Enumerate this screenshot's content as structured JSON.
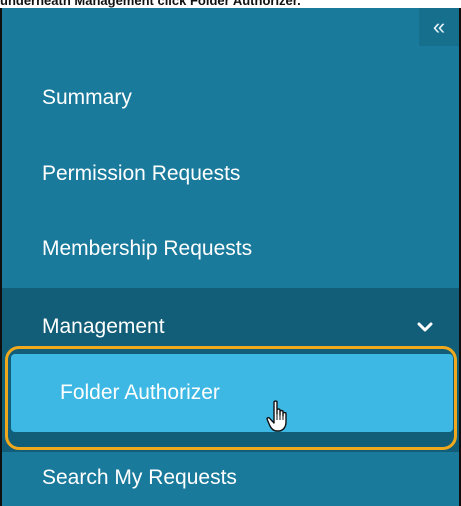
{
  "caption": "underneath Management click Folder Authorizer.",
  "sidebar": {
    "collapse_label": "«",
    "items": {
      "summary": "Summary",
      "permission_requests": "Permission Requests",
      "membership_requests": "Membership Requests",
      "management": "Management",
      "folder_authorizer": "Folder Authorizer",
      "search_my_requests": "Search My Requests"
    }
  },
  "colors": {
    "sidebar_bg": "#1a7a9b",
    "section_bg": "#125e78",
    "active_item_bg": "#3db7e3",
    "highlight_ring": "#f0a81c"
  },
  "icons": {
    "collapse": "double-chevron-left-icon",
    "expand": "chevron-down-icon",
    "cursor": "hand-pointer-cursor-icon"
  }
}
